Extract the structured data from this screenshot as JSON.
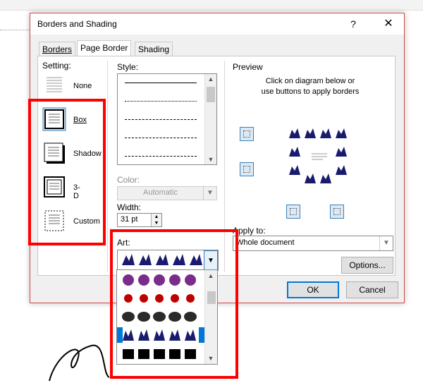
{
  "dialog": {
    "title": "Borders and Shading",
    "help": "?",
    "close": "✕"
  },
  "tabs": [
    {
      "label": "Borders"
    },
    {
      "label": "Page Border"
    },
    {
      "label": "Shading"
    }
  ],
  "setting": {
    "label": "Setting:",
    "options": [
      {
        "label": "None"
      },
      {
        "label": "Box"
      },
      {
        "label": "Shadow"
      },
      {
        "label": "3-D"
      },
      {
        "label": "Custom"
      }
    ]
  },
  "style": {
    "label": "Style:"
  },
  "color": {
    "label": "Color:",
    "value": "Automatic"
  },
  "width": {
    "label": "Width:",
    "value": "31 pt"
  },
  "art": {
    "label": "Art:"
  },
  "preview": {
    "label": "Preview",
    "hint_line1": "Click on diagram below or",
    "hint_line2": "use buttons to apply borders"
  },
  "apply_to": {
    "label": "Apply to:",
    "value": "Whole document"
  },
  "buttons": {
    "options": "Options...",
    "ok": "OK",
    "cancel": "Cancel"
  },
  "art_list": {
    "items": [
      {
        "name": "purple-butterflies"
      },
      {
        "name": "ladybugs"
      },
      {
        "name": "fish"
      },
      {
        "name": "bats"
      },
      {
        "name": "black-cats"
      }
    ],
    "selected_index": 3
  },
  "colors": {
    "accent": "#0078d7",
    "highlight": "#ff0000",
    "art_navy": "#1a1a6e"
  }
}
